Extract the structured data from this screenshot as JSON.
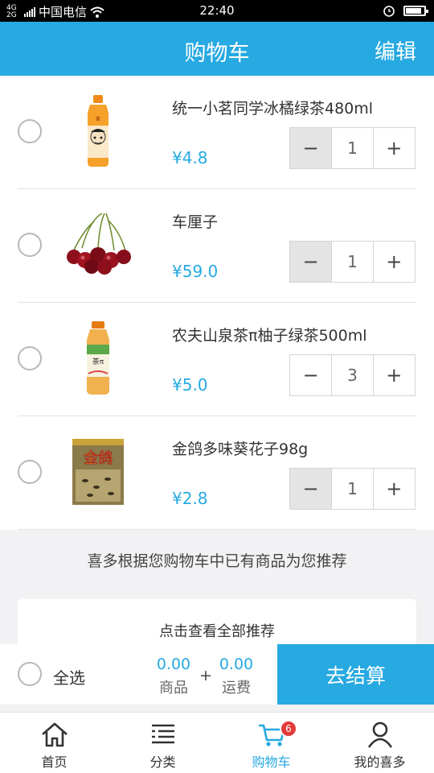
{
  "statusbar": {
    "network": "4G 2G",
    "carrier": "中国电信",
    "time": "22:40",
    "battery_level": 0.85
  },
  "header": {
    "title": "购物车",
    "edit_label": "编辑"
  },
  "cart": {
    "items": [
      {
        "name": "统一小茗同学冰橘绿茶480ml",
        "price": "¥4.8",
        "qty": "1",
        "minus_disabled": true,
        "image": "iced-tea-bottle"
      },
      {
        "name": "车厘子",
        "price": "¥59.0",
        "qty": "1",
        "minus_disabled": true,
        "image": "cherries"
      },
      {
        "name": "农夫山泉茶π柚子绿茶500ml",
        "price": "¥5.0",
        "qty": "3",
        "minus_disabled": false,
        "image": "tea-pi-bottle"
      },
      {
        "name": "金鸽多味葵花子98g",
        "price": "¥2.8",
        "qty": "1",
        "minus_disabled": true,
        "image": "sunflower-seeds-bag"
      }
    ],
    "minus": "−",
    "plus": "+"
  },
  "recommend": {
    "text": "喜多根据您购物车中已有商品为您推荐",
    "view_all": "点击查看全部推荐"
  },
  "checkout": {
    "select_all": "全选",
    "goods_value": "0.00",
    "goods_label": "商品",
    "plus": "+",
    "shipping_value": "0.00",
    "shipping_label": "运费",
    "button": "去结算"
  },
  "tabs": [
    {
      "label": "首页",
      "icon": "home-icon"
    },
    {
      "label": "分类",
      "icon": "category-list-icon"
    },
    {
      "label": "购物车",
      "icon": "cart-icon",
      "badge": "6",
      "active": true
    },
    {
      "label": "我的喜多",
      "icon": "profile-icon"
    }
  ],
  "colors": {
    "accent": "#27a9e1",
    "badge": "#e23a3a"
  }
}
